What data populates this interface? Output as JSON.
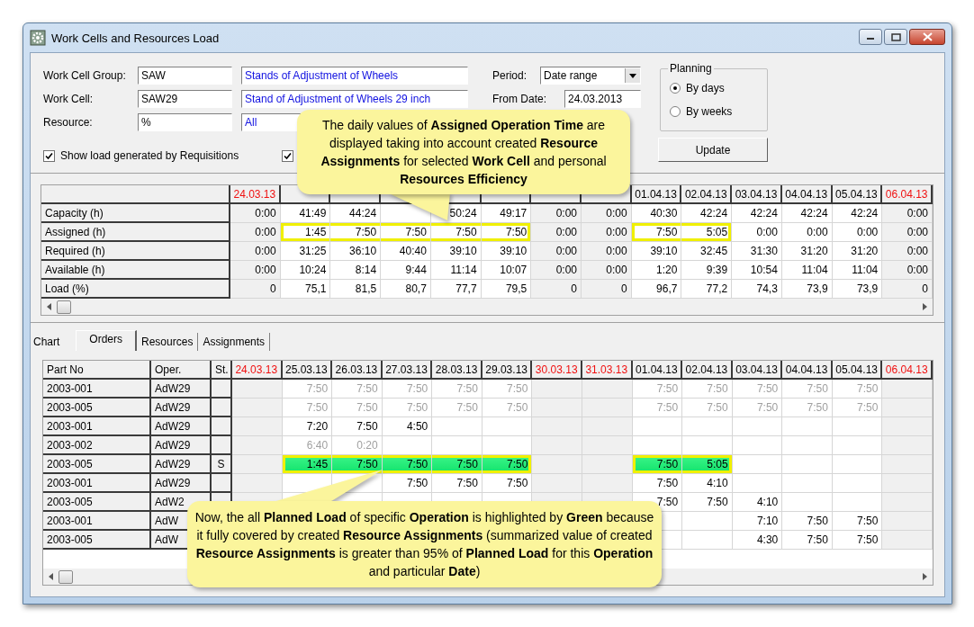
{
  "window": {
    "title": "Work Cells and Resources Load"
  },
  "form": {
    "fields": [
      {
        "label": "Work Cell Group:",
        "code": "SAW",
        "description": "Stands of Adjustment of Wheels"
      },
      {
        "label": "Work Cell:",
        "code": "SAW29",
        "description": "Stand of Adjustment of Wheels 29 inch"
      },
      {
        "label": "Resource:",
        "code": "%",
        "description": "All"
      }
    ],
    "checkboxes": [
      {
        "label": "Show load generated by Requisitions",
        "checked": true
      },
      {
        "checked": true
      }
    ],
    "period": {
      "label": "Period:",
      "value": "Date range"
    },
    "from_date": {
      "label": "From Date:",
      "value": "24.03.2013"
    },
    "planning": {
      "title": "Planning",
      "options": [
        {
          "label": "By days",
          "selected": true
        },
        {
          "label": "By weeks",
          "selected": false
        }
      ]
    },
    "update_button": "Update"
  },
  "top_grid": {
    "dates": [
      {
        "label": "24.03.13",
        "weekend": true
      },
      {
        "weekend": false
      },
      {
        "weekend": false
      },
      {
        "weekend": false
      },
      {
        "weekend": false
      },
      {
        "weekend": false
      },
      {
        "weekend": true
      },
      {
        "weekend": true
      },
      {
        "label": "01.04.13",
        "weekend": false
      },
      {
        "label": "02.04.13",
        "weekend": false
      },
      {
        "label": "03.04.13",
        "weekend": false
      },
      {
        "label": "04.04.13",
        "weekend": false
      },
      {
        "label": "05.04.13",
        "weekend": false
      },
      {
        "label": "06.04.13",
        "weekend": true
      }
    ],
    "rows": [
      {
        "label": "Capacity (h)",
        "cells": [
          "0:00",
          "41:49",
          "44:24",
          null,
          "50:24",
          "49:17",
          "0:00",
          "0:00",
          "40:30",
          "42:24",
          "42:24",
          "42:24",
          "42:24",
          "0:00"
        ]
      },
      {
        "label": "Assigned (h)",
        "cells": [
          {
            "v": "0:00",
            "hl": false
          },
          {
            "v": "1:45",
            "hl": true
          },
          {
            "v": "7:50",
            "hl": true
          },
          {
            "v": "7:50",
            "hl": true
          },
          {
            "v": "7:50",
            "hl": true
          },
          {
            "v": "7:50",
            "hl": true
          },
          {
            "v": "0:00",
            "hl": false
          },
          {
            "v": "0:00",
            "hl": false
          },
          {
            "v": "7:50",
            "hl": true
          },
          {
            "v": "5:05",
            "hl": true
          },
          {
            "v": "0:00",
            "hl": false
          },
          {
            "v": "0:00",
            "hl": false
          },
          {
            "v": "0:00",
            "hl": false
          },
          {
            "v": "0:00",
            "hl": false
          }
        ]
      },
      {
        "label": "Required (h)",
        "cells": [
          "0:00",
          "31:25",
          "36:10",
          "40:40",
          "39:10",
          "39:10",
          "0:00",
          "0:00",
          "39:10",
          "32:45",
          "31:30",
          "31:20",
          "31:20",
          "0:00"
        ]
      },
      {
        "label": "Available (h)",
        "cells": [
          "0:00",
          "10:24",
          "8:14",
          "9:44",
          "11:14",
          "10:07",
          "0:00",
          "0:00",
          "1:20",
          "9:39",
          "10:54",
          "11:04",
          "11:04",
          "0:00"
        ]
      },
      {
        "label": "Load (%)",
        "cells": [
          "0",
          "75,1",
          "81,5",
          "80,7",
          "77,7",
          "79,5",
          "0",
          "0",
          "96,7",
          "77,2",
          "74,3",
          "73,9",
          "73,9",
          "0"
        ]
      }
    ]
  },
  "tabs": [
    {
      "label": "Chart",
      "selected": false
    },
    {
      "label": "Orders",
      "selected": true
    },
    {
      "label": "Resources",
      "selected": false
    },
    {
      "label": "Assignments",
      "selected": false
    }
  ],
  "bottom_grid": {
    "columns": [
      "Part No",
      "Oper.",
      "St."
    ],
    "dates": [
      {
        "label": "24.03.13",
        "weekend": true
      },
      {
        "label": "25.03.13",
        "weekend": false
      },
      {
        "label": "26.03.13",
        "weekend": false
      },
      {
        "label": "27.03.13",
        "weekend": false
      },
      {
        "label": "28.03.13",
        "weekend": false
      },
      {
        "label": "29.03.13",
        "weekend": false
      },
      {
        "label": "30.03.13",
        "weekend": true
      },
      {
        "label": "31.03.13",
        "weekend": true
      },
      {
        "label": "01.04.13",
        "weekend": false
      },
      {
        "label": "02.04.13",
        "weekend": false
      },
      {
        "label": "03.04.13",
        "weekend": false
      },
      {
        "label": "04.04.13",
        "weekend": false
      },
      {
        "label": "05.04.13",
        "weekend": false
      },
      {
        "label": "06.04.13",
        "weekend": true
      }
    ],
    "rows": [
      {
        "part_no": "2003-001",
        "oper": "AdW29",
        "kind": "planned",
        "cells": [
          null,
          "7:50",
          "7:50",
          "7:50",
          "7:50",
          "7:50",
          null,
          null,
          "7:50",
          "7:50",
          "7:50",
          "7:50",
          "7:50",
          null
        ]
      },
      {
        "part_no": "2003-005",
        "oper": "AdW29",
        "kind": "planned",
        "cells": [
          null,
          "7:50",
          "7:50",
          "7:50",
          "7:50",
          "7:50",
          null,
          null,
          "7:50",
          "7:50",
          "7:50",
          "7:50",
          "7:50",
          null
        ]
      },
      {
        "part_no": "2003-001",
        "oper": "AdW29",
        "kind": "actual",
        "cells": [
          null,
          "7:20",
          "7:50",
          "4:50",
          null,
          null,
          null,
          null,
          null,
          null,
          null,
          null,
          null,
          null
        ]
      },
      {
        "part_no": "2003-002",
        "oper": "AdW29",
        "kind": "planned",
        "cells": [
          null,
          "6:40",
          "0:20",
          null,
          null,
          null,
          null,
          null,
          null,
          null,
          null,
          null,
          null,
          null
        ]
      },
      {
        "part_no": "2003-005",
        "oper": "AdW29",
        "status": "S",
        "kind": "covered",
        "cells": [
          null,
          "1:45",
          "7:50",
          "7:50",
          "7:50",
          "7:50",
          null,
          null,
          "7:50",
          "5:05",
          null,
          null,
          null,
          null
        ]
      },
      {
        "part_no": "2003-001",
        "oper": "AdW29",
        "kind": "actual",
        "cells": [
          null,
          null,
          null,
          "7:50",
          "7:50",
          "7:50",
          null,
          null,
          "7:50",
          "4:10",
          null,
          null,
          null,
          null
        ]
      },
      {
        "part_no": "2003-005",
        "oper": "AdW2",
        "kind": "actual",
        "cells": [
          null,
          null,
          null,
          null,
          null,
          null,
          null,
          null,
          "7:50",
          "7:50",
          "4:10",
          null,
          null,
          null
        ]
      },
      {
        "part_no": "2003-001",
        "oper": "AdW",
        "kind": "actual",
        "cells": [
          null,
          null,
          null,
          null,
          null,
          null,
          null,
          null,
          null,
          null,
          "7:10",
          "7:50",
          "7:50",
          null
        ]
      },
      {
        "part_no": "2003-005",
        "oper": "AdW",
        "kind": "actual",
        "cells": [
          null,
          null,
          null,
          null,
          null,
          null,
          null,
          null,
          null,
          null,
          "4:30",
          "7:50",
          "7:50",
          null
        ]
      }
    ]
  },
  "callouts": [
    {
      "text": "The daily values of **Assigned Operation Time** are displayed taking into account created **Resource Assignments** for selected **Work Cell** and personal **Resources Efficiency**"
    },
    {
      "text": "Now, the all **Planned Load** of specific **Operation** is highlighted by **Green** because it fully covered by created **Resource Assignments** (summarized value of created **Resource Assignments** is greater than 95% of **Planned Load** for this **Operation** and particular **Date**)"
    }
  ]
}
